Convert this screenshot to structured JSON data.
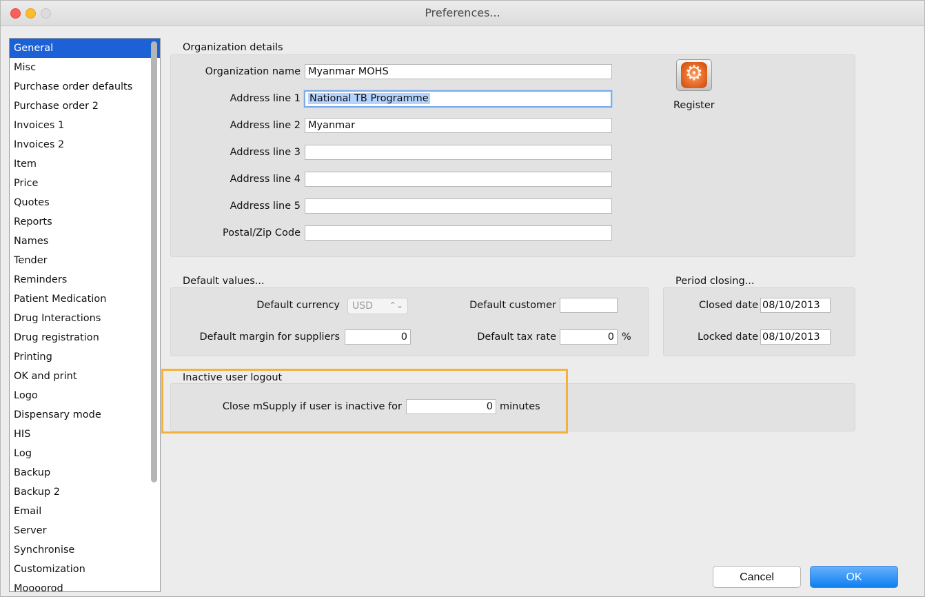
{
  "window": {
    "title": "Preferences..."
  },
  "sidebar": {
    "items": [
      {
        "label": "General",
        "selected": true
      },
      {
        "label": "Misc"
      },
      {
        "label": "Purchase order defaults"
      },
      {
        "label": "Purchase order 2"
      },
      {
        "label": "Invoices 1"
      },
      {
        "label": "Invoices 2"
      },
      {
        "label": "Item"
      },
      {
        "label": "Price"
      },
      {
        "label": "Quotes"
      },
      {
        "label": "Reports"
      },
      {
        "label": "Names"
      },
      {
        "label": "Tender"
      },
      {
        "label": "Reminders"
      },
      {
        "label": "Patient Medication"
      },
      {
        "label": "Drug Interactions"
      },
      {
        "label": "Drug registration"
      },
      {
        "label": "Printing"
      },
      {
        "label": "OK and print"
      },
      {
        "label": "Logo"
      },
      {
        "label": "Dispensary mode"
      },
      {
        "label": "HIS"
      },
      {
        "label": "Log"
      },
      {
        "label": "Backup"
      },
      {
        "label": "Backup 2"
      },
      {
        "label": "Email"
      },
      {
        "label": "Server"
      },
      {
        "label": "Synchronise"
      },
      {
        "label": "Customization"
      },
      {
        "label": "Moooorod"
      }
    ]
  },
  "organization": {
    "section_title": "Organization details",
    "fields": [
      {
        "label": "Organization name",
        "value": "Myanmar MOHS"
      },
      {
        "label": "Address line 1",
        "value": "National TB Programme"
      },
      {
        "label": "Address line 2",
        "value": "Myanmar"
      },
      {
        "label": "Address line 3",
        "value": ""
      },
      {
        "label": "Address line 4",
        "value": ""
      },
      {
        "label": "Address line 5",
        "value": ""
      },
      {
        "label": "Postal/Zip Code",
        "value": ""
      }
    ],
    "register_label": "Register",
    "register_icon": "gear-icon"
  },
  "defaults": {
    "section_title": "Default values...",
    "currency_label": "Default currency",
    "currency_value": "USD",
    "customer_label": "Default customer",
    "customer_value": "",
    "margin_label": "Default margin for suppliers",
    "margin_value": "0",
    "tax_label": "Default tax rate",
    "tax_value": "0",
    "tax_unit": "%"
  },
  "period": {
    "section_title": "Period closing...",
    "closed_label": "Closed date",
    "closed_value": "08/10/2013",
    "locked_label": "Locked date",
    "locked_value": "08/10/2013"
  },
  "inactive": {
    "section_title": "Inactive user logout",
    "label": "Close mSupply if user is inactive for",
    "value": "0",
    "unit": "minutes",
    "highlight_color": "#f5b23a"
  },
  "buttons": {
    "cancel": "Cancel",
    "ok": "OK"
  },
  "colors": {
    "selection": "#1c62d6",
    "ok_button": "#0d7ff1"
  }
}
